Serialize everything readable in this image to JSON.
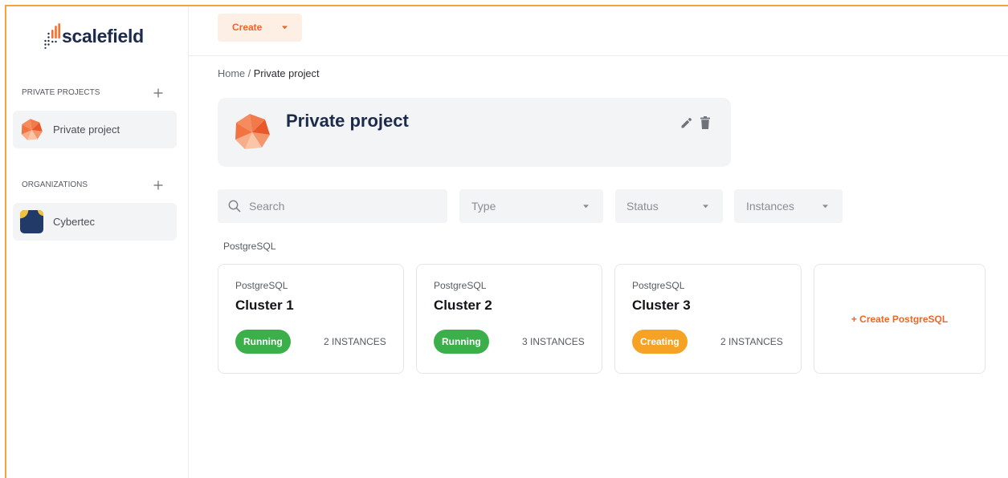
{
  "app": {
    "brand": "scalefield",
    "colors": {
      "accent": "#e9672b",
      "navy": "#1c2b4b",
      "window_border": "#f5a43c",
      "panel": "#f3f4f6"
    }
  },
  "sidebar": {
    "logo_icon": "scalefield-logo-icon",
    "sections": [
      {
        "title": "PRIVATE PROJECTS",
        "add_icon": "plus-icon",
        "items": [
          {
            "label": "Private project",
            "icon": "project-polyhedron-icon"
          }
        ]
      },
      {
        "title": "ORGANIZATIONS",
        "add_icon": "plus-icon",
        "items": [
          {
            "label": "Cybertec",
            "icon": "organization-logo-icon"
          }
        ]
      }
    ]
  },
  "toolbar": {
    "create_label": "Create",
    "create_icon": "caret-down-icon"
  },
  "breadcrumb": {
    "home": "Home",
    "separator": "/",
    "current": "Private project"
  },
  "project": {
    "title": "Private project",
    "icon": "project-polyhedron-icon",
    "edit_icon": "pencil-icon",
    "delete_icon": "trash-icon"
  },
  "filters": {
    "search": {
      "icon": "search-icon",
      "placeholder": "Search",
      "value": ""
    },
    "type": {
      "label": "Type",
      "icon": "caret-down-icon"
    },
    "status": {
      "label": "Status",
      "icon": "caret-down-icon"
    },
    "instances": {
      "label": "Instances",
      "icon": "caret-down-icon"
    }
  },
  "section": {
    "title": "PostgreSQL"
  },
  "clusters": [
    {
      "engine": "PostgreSQL",
      "name": "Cluster 1",
      "status": "Running",
      "status_color": "#3aaf4a",
      "instances": "2 INSTANCES"
    },
    {
      "engine": "PostgreSQL",
      "name": "Cluster 2",
      "status": "Running",
      "status_color": "#3aaf4a",
      "instances": "3 INSTANCES"
    },
    {
      "engine": "PostgreSQL",
      "name": "Cluster 3",
      "status": "Creating",
      "status_color": "#f5a225",
      "instances": "2 INSTANCES"
    }
  ],
  "create_card": {
    "label": "+ Create PostgreSQL"
  }
}
